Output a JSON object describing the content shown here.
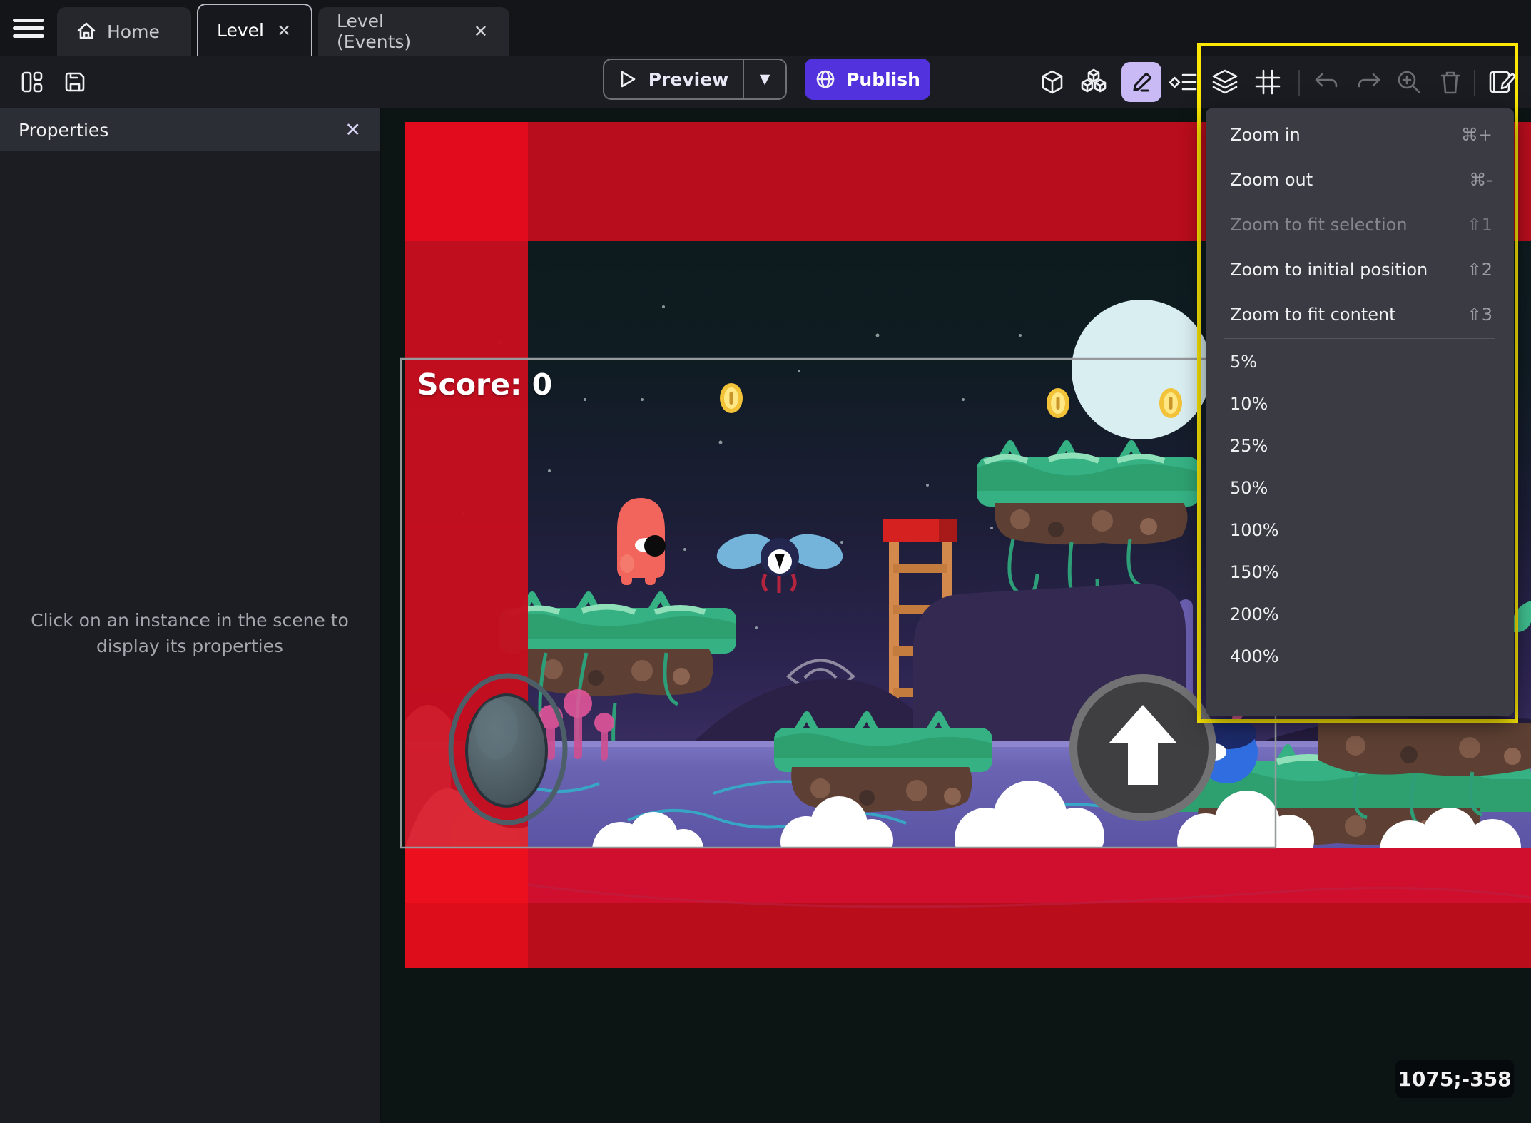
{
  "tabs": {
    "home": {
      "label": "Home"
    },
    "level": {
      "label": "Level",
      "close": "✕"
    },
    "level_events": {
      "label": "Level (Events)",
      "close": "✕"
    }
  },
  "toolbar": {
    "preview_label": "Preview",
    "publish_label": "Publish"
  },
  "properties_panel": {
    "title": "Properties",
    "close": "✕",
    "empty_message": "Click on an instance in the scene to display its properties"
  },
  "scene": {
    "score_label": "Score: 0",
    "cursor_coordinates": "1075;-358"
  },
  "zoom_menu": {
    "items": [
      {
        "label": "Zoom in",
        "shortcut": "⌘+"
      },
      {
        "label": "Zoom out",
        "shortcut": "⌘-"
      },
      {
        "label": "Zoom to fit selection",
        "shortcut": "⇧1"
      },
      {
        "label": "Zoom to initial position",
        "shortcut": "⇧2"
      },
      {
        "label": "Zoom to fit content",
        "shortcut": "⇧3"
      }
    ],
    "levels": [
      "5%",
      "10%",
      "25%",
      "50%",
      "100%",
      "150%",
      "200%",
      "400%"
    ]
  },
  "colors": {
    "publish_accent": "#5232dd",
    "tool_highlight": "#c9baf6",
    "selection_highlight_yellow": "#fce803",
    "menu_background": "#3a3b43",
    "red_band_bright": "#e20b1e",
    "red_band_dark": "#b80d1c",
    "red_band_crimson": "#d00f2e"
  }
}
